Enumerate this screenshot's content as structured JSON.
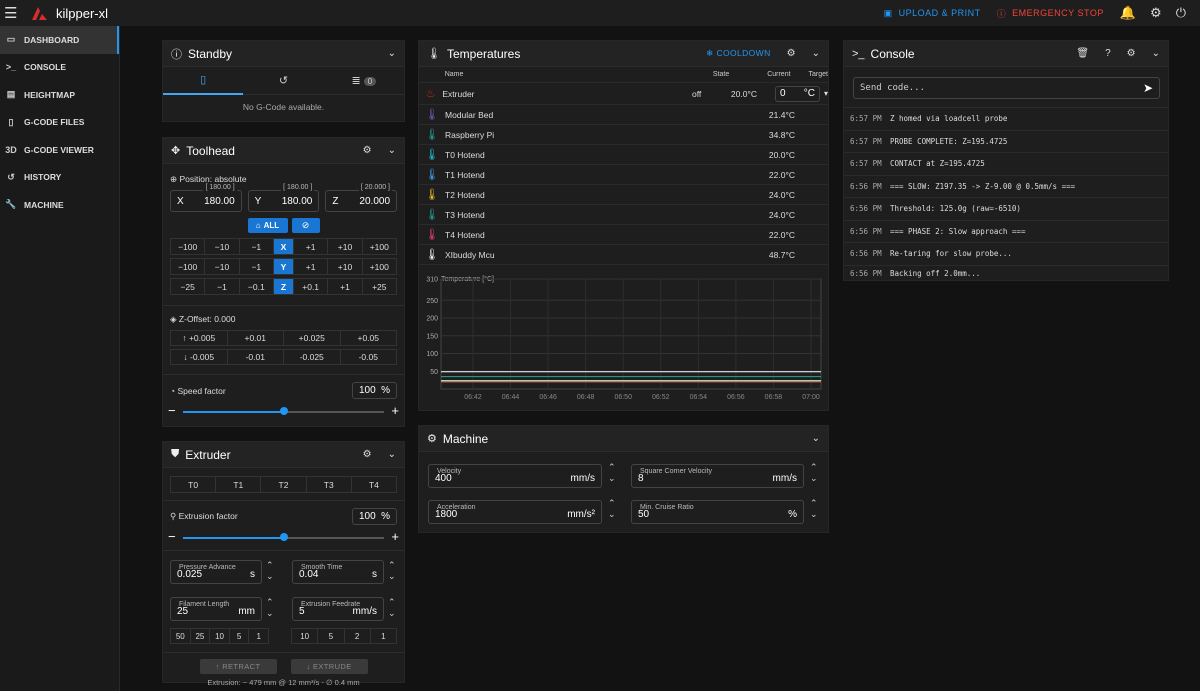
{
  "app": {
    "title": "kilpper-xl"
  },
  "topbar": {
    "upload_label": "UPLOAD & PRINT",
    "stop_label": "EMERGENCY STOP"
  },
  "sidebar": {
    "items": [
      {
        "label": "DASHBOARD",
        "icon": "monitor-icon",
        "glyph": "▭"
      },
      {
        "label": "CONSOLE",
        "icon": "console-icon",
        "glyph": ">_"
      },
      {
        "label": "HEIGHTMAP",
        "icon": "heightmap-icon",
        "glyph": "▤"
      },
      {
        "label": "G-CODE FILES",
        "icon": "file-icon",
        "glyph": "▯"
      },
      {
        "label": "G-CODE VIEWER",
        "icon": "viewer-3d-icon",
        "glyph": "3D"
      },
      {
        "label": "HISTORY",
        "icon": "history-icon",
        "glyph": "↺"
      },
      {
        "label": "MACHINE",
        "icon": "wrench-icon",
        "glyph": "🔧"
      }
    ]
  },
  "standby": {
    "title": "Standby",
    "badge": "0",
    "empty": "No G-Code available."
  },
  "toolhead": {
    "title": "Toolhead",
    "position_label": "Position: absolute",
    "x": {
      "axis": "X",
      "value": "180.00",
      "limit": "[ 180.00 ]"
    },
    "y": {
      "axis": "Y",
      "value": "180.00",
      "limit": "[ 180.00 ]"
    },
    "z": {
      "axis": "Z",
      "value": "20.000",
      "limit": "[ 20.000 ]"
    },
    "home_all": "ALL",
    "rows": [
      {
        "axis": "X",
        "neg": [
          "−100",
          "−10",
          "−1"
        ],
        "pos": [
          "+1",
          "+10",
          "+100"
        ]
      },
      {
        "axis": "Y",
        "neg": [
          "−100",
          "−10",
          "−1"
        ],
        "pos": [
          "+1",
          "+10",
          "+100"
        ]
      },
      {
        "axis": "Z",
        "neg": [
          "−25",
          "−1",
          "−0.1"
        ],
        "pos": [
          "+0.1",
          "+1",
          "+25"
        ]
      }
    ],
    "zoffset_label": "Z-Offset: 0.000",
    "zoffset_up": [
      "+0.005",
      "+0.01",
      "+0.025",
      "+0.05"
    ],
    "zoffset_down": [
      "-0.005",
      "-0.01",
      "-0.025",
      "-0.05"
    ],
    "speed_label": "Speed factor",
    "speed_value": "100",
    "speed_unit": "%",
    "speed_fraction": 0.5
  },
  "extruder": {
    "title": "Extruder",
    "tools": [
      "T0",
      "T1",
      "T2",
      "T3",
      "T4"
    ],
    "factor_label": "Extrusion factor",
    "factor_value": "100",
    "factor_unit": "%",
    "factor_fraction": 0.5,
    "pressure_advance": {
      "label": "Pressure Advance",
      "value": "0.025",
      "unit": "s"
    },
    "smooth_time": {
      "label": "Smooth Time",
      "value": "0.04",
      "unit": "s"
    },
    "filament_length": {
      "label": "Filament Length",
      "value": "25",
      "unit": "mm"
    },
    "feedrate": {
      "label": "Extrusion Feedrate",
      "value": "5",
      "unit": "mm/s"
    },
    "length_presets": [
      "50",
      "25",
      "10",
      "5",
      "1"
    ],
    "feed_presets": [
      "10",
      "5",
      "2",
      "1"
    ],
    "retract_label": "RETRACT",
    "extrude_label": "EXTRUDE",
    "info": "Extrusion: ~ 479 mm @ 12 mm³/s - ∅ 0.4 mm"
  },
  "temperatures": {
    "title": "Temperatures",
    "cooldown_label": "COOLDOWN",
    "headers": {
      "name": "Name",
      "state": "State",
      "current": "Current",
      "target": "Target"
    },
    "rows": [
      {
        "name": "Extruder",
        "state": "off",
        "current": "20.0°C",
        "target": "0",
        "unit": "°C",
        "color": "#c62828"
      },
      {
        "name": "Modular Bed",
        "state": "",
        "current": "21.4°C",
        "color": "#7e57c2"
      },
      {
        "name": "Raspberry Pi",
        "state": "",
        "current": "34.8°C",
        "color": "#26a69a"
      },
      {
        "name": "T0 Hotend",
        "state": "",
        "current": "20.0°C",
        "color": "#26c6da"
      },
      {
        "name": "T1 Hotend",
        "state": "",
        "current": "22.0°C",
        "color": "#42a5f5"
      },
      {
        "name": "T2 Hotend",
        "state": "",
        "current": "24.0°C",
        "color": "#fbc02d"
      },
      {
        "name": "T3 Hotend",
        "state": "",
        "current": "24.0°C",
        "color": "#26a69a"
      },
      {
        "name": "T4 Hotend",
        "state": "",
        "current": "22.0°C",
        "color": "#ec407a"
      },
      {
        "name": "XIbuddy Mcu",
        "state": "",
        "current": "48.7°C",
        "color": "#ffffff"
      }
    ]
  },
  "chart_data": {
    "type": "line",
    "ylabel": "Temperature [°C]",
    "yticks": [
      "310",
      "250",
      "200",
      "150",
      "100",
      "50"
    ],
    "y_tick_values": [
      310,
      250,
      200,
      150,
      100,
      50
    ],
    "ylim": [
      0,
      310
    ],
    "x": [
      "06:42",
      "06:44",
      "06:46",
      "06:48",
      "06:50",
      "06:52",
      "06:54",
      "06:56",
      "06:58",
      "07:00"
    ],
    "series": [
      {
        "color": "#ef5350",
        "values": [
          20,
          20,
          20,
          20,
          20,
          20,
          20,
          20,
          20,
          20
        ]
      },
      {
        "color": "#7e57c2",
        "values": [
          21.4,
          21.4,
          21.4,
          21.4,
          21.4,
          21.4,
          21.4,
          21.4,
          21.4,
          21.4
        ]
      },
      {
        "color": "#26a69a",
        "values": [
          34.8,
          34.8,
          34.8,
          34.8,
          34.8,
          34.8,
          34.8,
          34.8,
          34.8,
          34.8
        ]
      },
      {
        "color": "#42a5f5",
        "values": [
          22,
          22,
          22,
          22,
          22,
          22,
          22,
          22,
          22,
          22
        ]
      },
      {
        "color": "#fbc02d",
        "values": [
          24,
          24,
          24,
          24,
          24,
          24,
          24,
          24,
          24,
          24
        ]
      },
      {
        "color": "#ffffff",
        "values": [
          48.7,
          48.7,
          48.7,
          48.7,
          48.7,
          48.7,
          48.7,
          48.7,
          48.7,
          48.7
        ]
      }
    ]
  },
  "machine": {
    "title": "Machine",
    "velocity": {
      "label": "Velocity",
      "value": "400",
      "unit": "mm/s"
    },
    "scv": {
      "label": "Square Corner Velocity",
      "value": "8",
      "unit": "mm/s"
    },
    "accel": {
      "label": "Acceleration",
      "value": "1800",
      "unit": "mm/s²"
    },
    "mcr": {
      "label": "Min. Cruise Ratio",
      "value": "50",
      "unit": "%"
    }
  },
  "console": {
    "title": "Console",
    "placeholder": "Send code...",
    "lines": [
      {
        "ts": "6:57 PM",
        "msg": "Z homed via loadcell probe"
      },
      {
        "ts": "6:57 PM",
        "msg": "PROBE COMPLETE: Z=195.4725"
      },
      {
        "ts": "6:57 PM",
        "msg": "CONTACT at Z=195.4725"
      },
      {
        "ts": "6:56 PM",
        "msg": "=== SLOW: Z197.35 -> Z-9.00 @ 0.5mm/s ==="
      },
      {
        "ts": "6:56 PM",
        "msg": "Threshold: 125.0g (raw=-6510)"
      },
      {
        "ts": "6:56 PM",
        "msg": "=== PHASE 2: Slow approach ==="
      },
      {
        "ts": "6:56 PM",
        "msg": "Re-taring for slow probe..."
      },
      {
        "ts": "6:56 PM",
        "msg": "Backing off 2.0mm..."
      }
    ]
  }
}
